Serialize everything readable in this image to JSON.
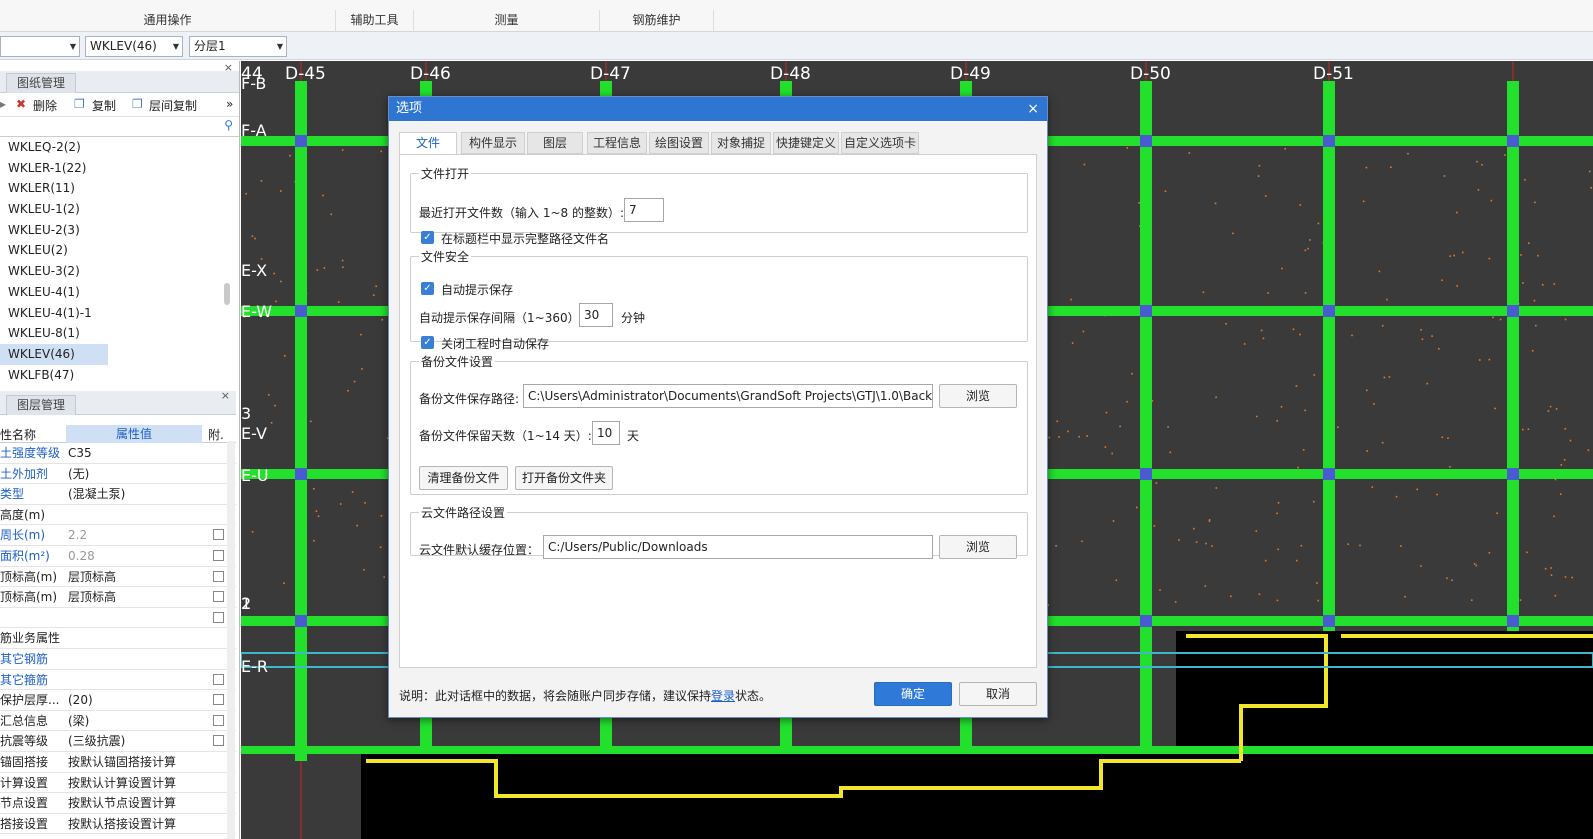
{
  "ribbon": {
    "groups": [
      "通用操作",
      "辅助工具",
      "测量",
      "钢筋维护"
    ]
  },
  "toolbar2": {
    "combo1": "",
    "combo2": "WKLEV(46)",
    "combo3": "分层1"
  },
  "drawing_panel": {
    "title": "图纸管理",
    "close": "×",
    "delete_label": "删除",
    "copy_label": "复制",
    "floor_copy_label": "层间复制",
    "more": "»",
    "items": [
      "WKLEQ-2(2)",
      "WKLER-1(22)",
      "WKLER(11)",
      "WKLEU-1(2)",
      "WKLEU-2(3)",
      "WKLEU(2)",
      "WKLEU-3(2)",
      "WKLEU-4(1)",
      "WKLEU-4(1)-1",
      "WKLEU-8(1)",
      "WKLEV(46)",
      "WKLFB(47)"
    ],
    "selected": "WKLEV(46)"
  },
  "layer_panel": {
    "title": "图层管理",
    "close": "×",
    "col_name": "性名称",
    "col_value": "属性值",
    "col_attach": "附."
  },
  "properties": [
    {
      "name": "土强度等级",
      "value": "C35",
      "blue": true,
      "check": false
    },
    {
      "name": "土外加剂",
      "value": "(无)",
      "blue": true,
      "check": false
    },
    {
      "name": "类型",
      "value": "(混凝土泵)",
      "blue": true,
      "check": false
    },
    {
      "name": "高度(m)",
      "value": "",
      "blue": false,
      "check": false
    },
    {
      "name": "周长(m)",
      "value": "2.2",
      "blue": true,
      "check": true,
      "gray": true
    },
    {
      "name": "面积(m²)",
      "value": "0.28",
      "blue": true,
      "check": true,
      "gray": true
    },
    {
      "name": "顶标高(m)",
      "value": "层顶标高",
      "blue": false,
      "check": true
    },
    {
      "name": "顶标高(m)",
      "value": "层顶标高",
      "blue": false,
      "check": true
    },
    {
      "name": "",
      "value": "",
      "blue": false,
      "check": true
    },
    {
      "name": "筋业务属性",
      "value": "",
      "blue": false,
      "check": false
    },
    {
      "name": "其它钢筋",
      "value": "",
      "blue": true,
      "check": false
    },
    {
      "name": "其它箍筋",
      "value": "",
      "blue": true,
      "check": true
    },
    {
      "name": "保护层厚...",
      "value": "(20)",
      "blue": false,
      "check": true
    },
    {
      "name": "汇总信息",
      "value": "(梁)",
      "blue": false,
      "check": true
    },
    {
      "name": "抗震等级",
      "value": "(三级抗震)",
      "blue": false,
      "check": true
    },
    {
      "name": "锚固搭接",
      "value": "按默认锚固搭接计算",
      "blue": false,
      "check": false
    },
    {
      "name": "计算设置",
      "value": "按默认计算设置计算",
      "blue": false,
      "check": false
    },
    {
      "name": "节点设置",
      "value": "按默认节点设置计算",
      "blue": false,
      "check": false
    },
    {
      "name": "搭接设置",
      "value": "按默认搭接设置计算",
      "blue": false,
      "check": false
    }
  ],
  "cad": {
    "axis_labels": [
      "D-45",
      "D-46",
      "D-47",
      "D-48",
      "D-49",
      "D-50",
      "D-51",
      "44"
    ],
    "row_labels": [
      "F-B",
      "F-A",
      "E-X",
      "E-W",
      "E-V",
      "E-U",
      "E-R",
      "3",
      "1",
      "2"
    ]
  },
  "dialog": {
    "title": "选项",
    "close": "×",
    "tabs": [
      "文件",
      "构件显示",
      "图层",
      "工程信息",
      "绘图设置",
      "对象捕捉",
      "快捷键定义",
      "自定义选项卡"
    ],
    "active_tab": "文件",
    "file_open": {
      "legend": "文件打开",
      "recent_label": "最近打开文件数（输入 1~8 的整数）:",
      "recent_value": "7",
      "fullpath_label": "在标题栏中显示完整路径文件名"
    },
    "file_safety": {
      "legend": "文件安全",
      "autosave_label": "自动提示保存",
      "interval_label": "自动提示保存间隔（1~360）",
      "interval_value": "30",
      "interval_unit": "分钟",
      "close_save_label": "关闭工程时自动保存"
    },
    "backup": {
      "legend": "备份文件设置",
      "path_label": "备份文件保存路径:",
      "path_value": "C:\\Users\\Administrator\\Documents\\GrandSoft Projects\\GTJ\\1.0\\Backup",
      "browse": "浏览",
      "days_label": "备份文件保留天数（1~14 天）:",
      "days_value": "10",
      "days_unit": "天",
      "clean_button": "清理备份文件",
      "open_button": "打开备份文件夹"
    },
    "cloud": {
      "legend": "云文件路径设置",
      "cache_label": "云文件默认缓存位置：",
      "cache_value": "C:/Users/Public/Downloads",
      "browse": "浏览"
    },
    "note_prefix": "说明：此对话框中的数据，将会随账户同步存储，建议保持",
    "note_link": "登录",
    "note_suffix": "状态。",
    "ok": "确定",
    "cancel": "取消"
  },
  "colors": {
    "cad_bg": "#3a3a3a",
    "beam_green": "#22e02c",
    "axis_red": "#d22020",
    "dialog_title": "#2f76d2",
    "accent_blue": "#2f7ad8"
  }
}
